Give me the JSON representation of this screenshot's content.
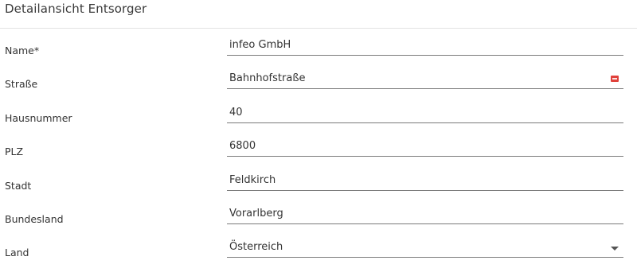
{
  "panel": {
    "title": "Detailansicht Entsorger"
  },
  "fields": [
    {
      "label": "Name*",
      "value": "infeo GmbH"
    },
    {
      "label": "Straße",
      "value": "Bahnhofstraße"
    },
    {
      "label": "Hausnummer",
      "value": "40"
    },
    {
      "label": "PLZ",
      "value": "6800"
    },
    {
      "label": "Stadt",
      "value": "Feldkirch"
    },
    {
      "label": "Bundesland",
      "value": "Vorarlberg"
    },
    {
      "label": "Land",
      "value": "Österreich"
    }
  ],
  "icons": {
    "street_autofill": "autofill-icon",
    "country_dropdown": "chevron-down-icon"
  },
  "colors": {
    "autofill_icon": "#e0413b",
    "underline": "#7a7a7a",
    "divider": "#e3e3e3"
  }
}
